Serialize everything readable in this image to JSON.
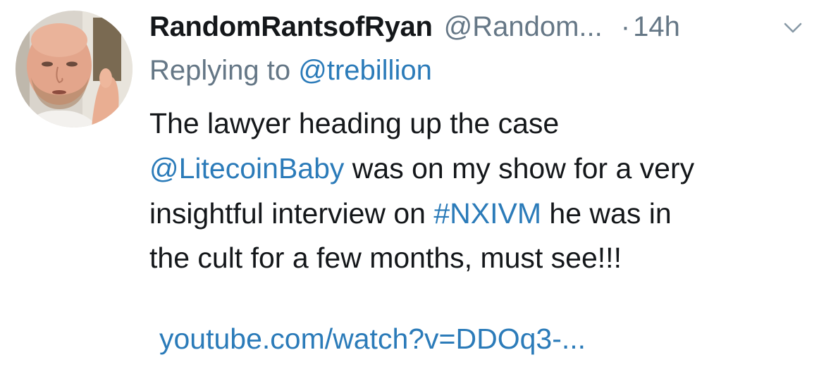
{
  "tweet": {
    "display_name": "RandomRantsofRyan",
    "handle": "@Random...",
    "dot": "·",
    "time": "14h",
    "reply_prefix": "Replying to",
    "reply_to": "@trebillion",
    "body": {
      "line1": "The lawyer heading up the case",
      "mention": "@LitecoinBaby",
      "line2_rest": " was on my show for a very",
      "line3_pre": "insightful interview on ",
      "hashtag": "#NXIVM",
      "line3_post": " he was in",
      "line4": "the cult for a few months, must see!!!"
    },
    "link": "youtube.com/watch?v=DDOq3-..."
  },
  "icons": {
    "menu": "chevron-down-icon"
  },
  "colors": {
    "link": "#2b7bb9",
    "muted": "#657786",
    "text": "#14171a"
  }
}
